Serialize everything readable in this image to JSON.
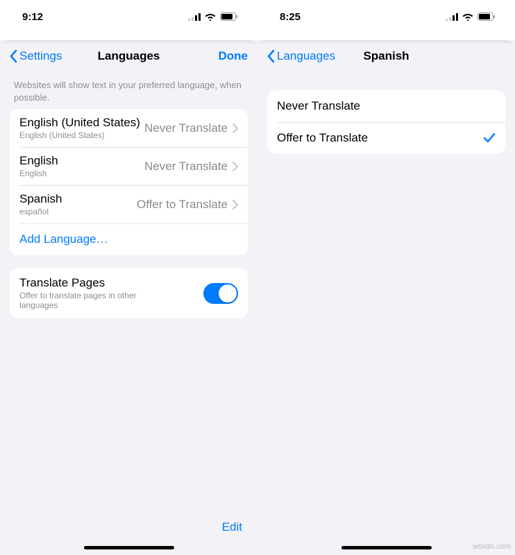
{
  "left": {
    "statusTime": "9:12",
    "nav": {
      "back": "Settings",
      "title": "Languages",
      "done": "Done"
    },
    "hint": "Websites will show text in your preferred language, when possible.",
    "languages": [
      {
        "title": "English (United States)",
        "sub": "English (United States)",
        "setting": "Never Translate"
      },
      {
        "title": "English",
        "sub": "English",
        "setting": "Never Translate"
      },
      {
        "title": "Spanish",
        "sub": "español",
        "setting": "Offer to Translate"
      }
    ],
    "addLanguage": "Add Language…",
    "translatePages": {
      "title": "Translate Pages",
      "sub": "Offer to translate pages in other languages"
    },
    "edit": "Edit"
  },
  "right": {
    "statusTime": "8:25",
    "nav": {
      "back": "Languages",
      "title": "Spanish"
    },
    "options": [
      {
        "label": "Never Translate",
        "checked": false
      },
      {
        "label": "Offer to Translate",
        "checked": true
      }
    ]
  },
  "watermark": "wsxdn.com"
}
